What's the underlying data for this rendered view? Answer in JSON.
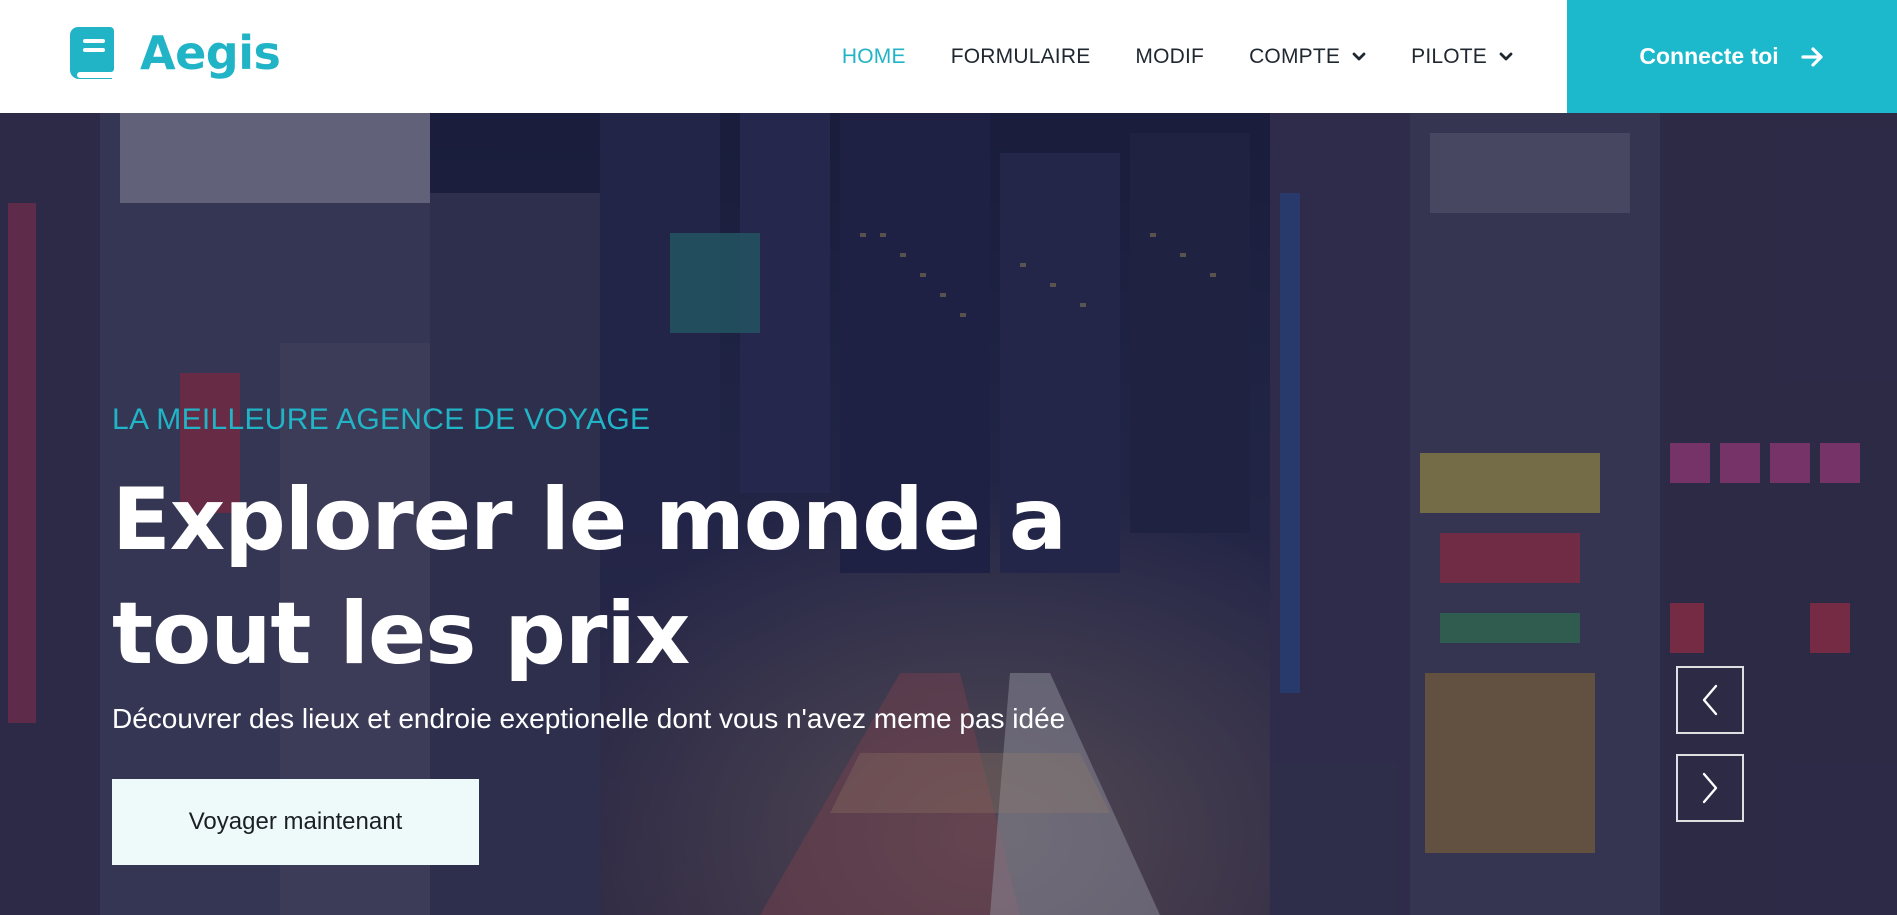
{
  "brand": {
    "name": "Aegis",
    "icon": "book-icon",
    "color": "#21b4c6"
  },
  "nav": {
    "items": [
      {
        "label": "HOME",
        "active": true
      },
      {
        "label": "FORMULAIRE",
        "active": false
      },
      {
        "label": "MODIF",
        "active": false
      },
      {
        "label": "COMPTE",
        "active": false,
        "dropdown": true
      },
      {
        "label": "PILOTE",
        "active": false,
        "dropdown": true
      }
    ],
    "cta_label": "Connecte toi",
    "cta_icon": "arrow-right-icon",
    "cta_color": "#1cb8cc"
  },
  "hero": {
    "tagline": "LA MEILLEURE AGENCE DE VOYAGE",
    "title_line1": "Explorer le monde a",
    "title_line2": "tout les prix",
    "subtitle": "Découvrer des lieux et endroie exeptionelle dont vous n'avez meme pas idée",
    "button_label": "Voyager maintenant",
    "background": "night city street with neon signs",
    "carousel": {
      "prev_icon": "chevron-left-icon",
      "next_icon": "chevron-right-icon"
    }
  }
}
